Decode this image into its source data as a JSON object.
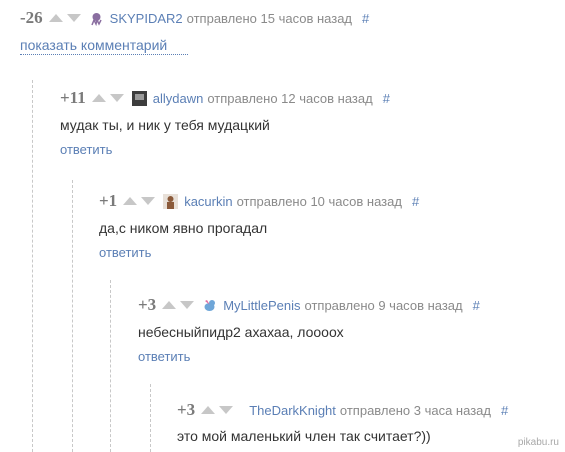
{
  "comments": [
    {
      "rating": "-26",
      "user": "SKYPIDAR2",
      "meta": "отправлено 15 часов назад",
      "hash": "#",
      "text": "",
      "reply": "",
      "show_label": "показать комментарий",
      "avatar_color": "#8a6ea0"
    },
    {
      "rating": "+11",
      "user": "allydawn",
      "meta": "отправлено 12 часов назад",
      "hash": "#",
      "text": "мудак ты, и ник у тебя мудацкий",
      "reply": "ответить",
      "avatar_color": "#3d3d3d"
    },
    {
      "rating": "+1",
      "user": "kacurkin",
      "meta": "отправлено 10 часов назад",
      "hash": "#",
      "text": "да,с ником явно прогадал",
      "reply": "ответить",
      "avatar_color": "#8b5a3a"
    },
    {
      "rating": "+3",
      "user": "MyLittlePenis",
      "meta": "отправлено 9 часов назад",
      "hash": "#",
      "text": "небесныйпидр2 ахахаа, лоооох",
      "reply": "ответить",
      "avatar_color": "#6fa6d8"
    },
    {
      "rating": "+3",
      "user": "TheDarkKnight",
      "meta": "отправлено 3 часа назад",
      "hash": "#",
      "text": "это мой маленький член так считает?))",
      "reply": "",
      "avatar_color": ""
    }
  ],
  "watermark": "pikabu.ru"
}
